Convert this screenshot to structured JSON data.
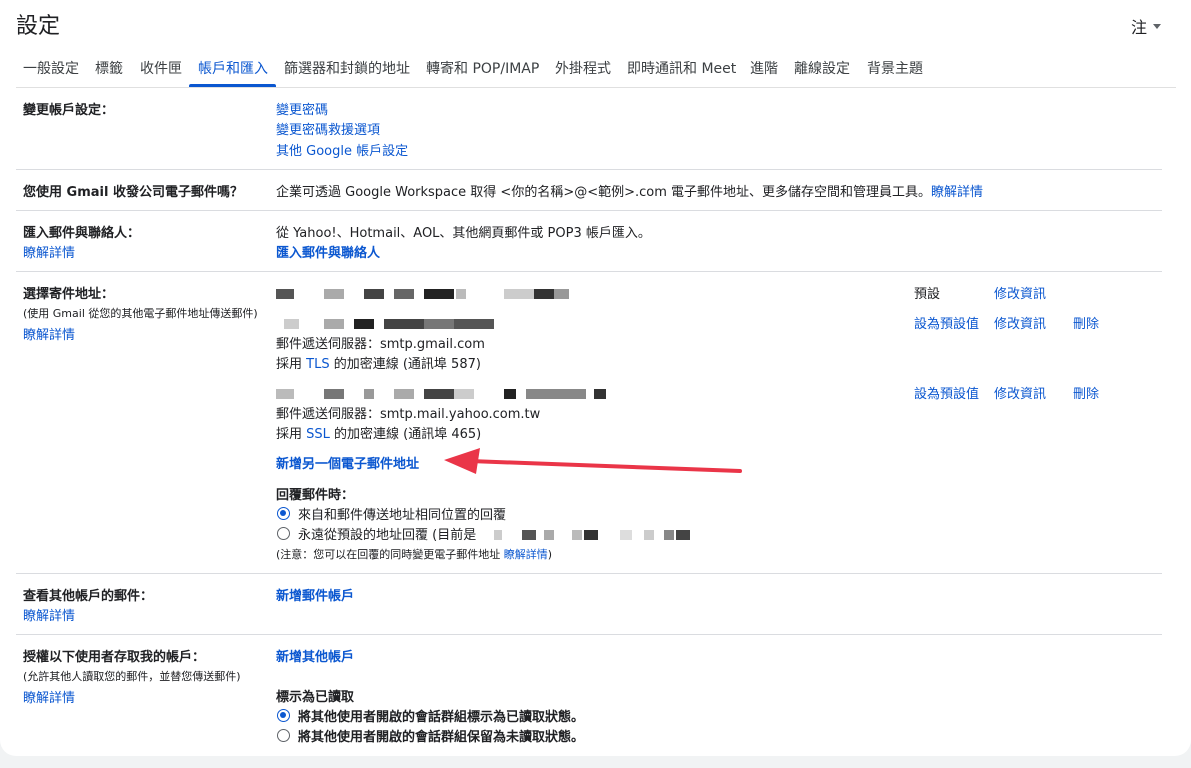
{
  "header": {
    "title": "設定",
    "language": "注"
  },
  "tabs": [
    {
      "label": "一般設定"
    },
    {
      "label": "標籤"
    },
    {
      "label": "收件匣"
    },
    {
      "label": "帳戶和匯入",
      "active": true
    },
    {
      "label": "篩選器和封鎖的地址"
    },
    {
      "label": "轉寄和 POP/IMAP"
    },
    {
      "label": "外掛程式"
    },
    {
      "label": "即時通訊和 Meet"
    },
    {
      "label": "進階"
    },
    {
      "label": "離線設定"
    },
    {
      "label": "背景主題"
    }
  ],
  "change_account": {
    "label": "變更帳戶設定：",
    "links": [
      "變更密碼",
      "變更密碼救援選項",
      "其他 Google 帳戶設定"
    ]
  },
  "workspace": {
    "label": "您使用 Gmail 收發公司電子郵件嗎？",
    "text": "企業可透過 Google Workspace 取得 <你的名稱>@<範例>.com 電子郵件地址、更多儲存空間和管理員工具。",
    "link": "瞭解詳情"
  },
  "import": {
    "label": "匯入郵件與聯絡人：",
    "learn_more": "瞭解詳情",
    "text": "從 Yahoo!、Hotmail、AOL、其他網頁郵件或 POP3 帳戶匯入。",
    "action": "匯入郵件與聯絡人"
  },
  "send_as": {
    "label": "選擇寄件地址：",
    "sublabel": "(使用 Gmail 從您的其他電子郵件地址傳送郵件)",
    "learn_more": "瞭解詳情",
    "default_text": "預設",
    "edit_info": "修改資訊",
    "set_default": "設為預設值",
    "delete": "刪除",
    "account2": {
      "server": "郵件遞送伺服器：smtp.gmail.com",
      "enc_prefix": "採用 ",
      "enc_protocol": "TLS",
      "enc_suffix": " 的加密連線 (通訊埠 587)"
    },
    "account3": {
      "server": "郵件遞送伺服器：smtp.mail.yahoo.com.tw",
      "enc_prefix": "採用 ",
      "enc_protocol": "SSL",
      "enc_suffix": " 的加密連線 (通訊埠 465)"
    },
    "add_another": "新增另一個電子郵件地址",
    "reply_heading": "回覆郵件時：",
    "reply_opt1": "來自和郵件傳送地址相同位置的回覆",
    "reply_opt2": "永遠從預設的地址回覆 (目前是",
    "reply_note_prefix": "(注意：您可以在回覆的同時變更電子郵件地址 ",
    "reply_note_link": "瞭解詳情",
    "reply_note_suffix": ")"
  },
  "check_mail": {
    "label": "查看其他帳戶的郵件：",
    "learn_more": "瞭解詳情",
    "action": "新增郵件帳戶"
  },
  "grant_access": {
    "label": "授權以下使用者存取我的帳戶：",
    "sublabel": "(允許其他人讀取您的郵件，並替您傳送郵件)",
    "learn_more": "瞭解詳情",
    "action": "新增其他帳戶",
    "mark_heading": "標示為已讀取",
    "mark_opt1": "將其他使用者開啟的會話群組標示為已讀取狀態。",
    "mark_opt2": "將其他使用者開啟的會話群組保留為未讀取狀態。"
  },
  "colors": {
    "accent": "#0b57d0",
    "arrow": "#ea3548",
    "divider": "#dadce0"
  },
  "icons": [
    "caret-down-icon",
    "arrow-annotation-icon"
  ]
}
